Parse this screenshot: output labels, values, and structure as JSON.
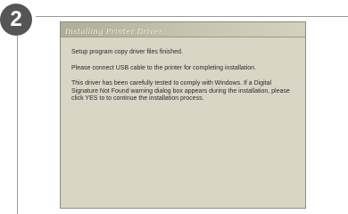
{
  "step": {
    "number": "2"
  },
  "dialog": {
    "title": "Installing Printer Driver...",
    "messages": [
      "Setup program copy driver files finished.",
      "Please connect USB cable to the printer for completing installation.",
      "This driver has been carefully tested to comply with Windows. If a Digital Signature Not Found warning dialog box appears during the installation, please click YES to to continue the installation process."
    ]
  }
}
